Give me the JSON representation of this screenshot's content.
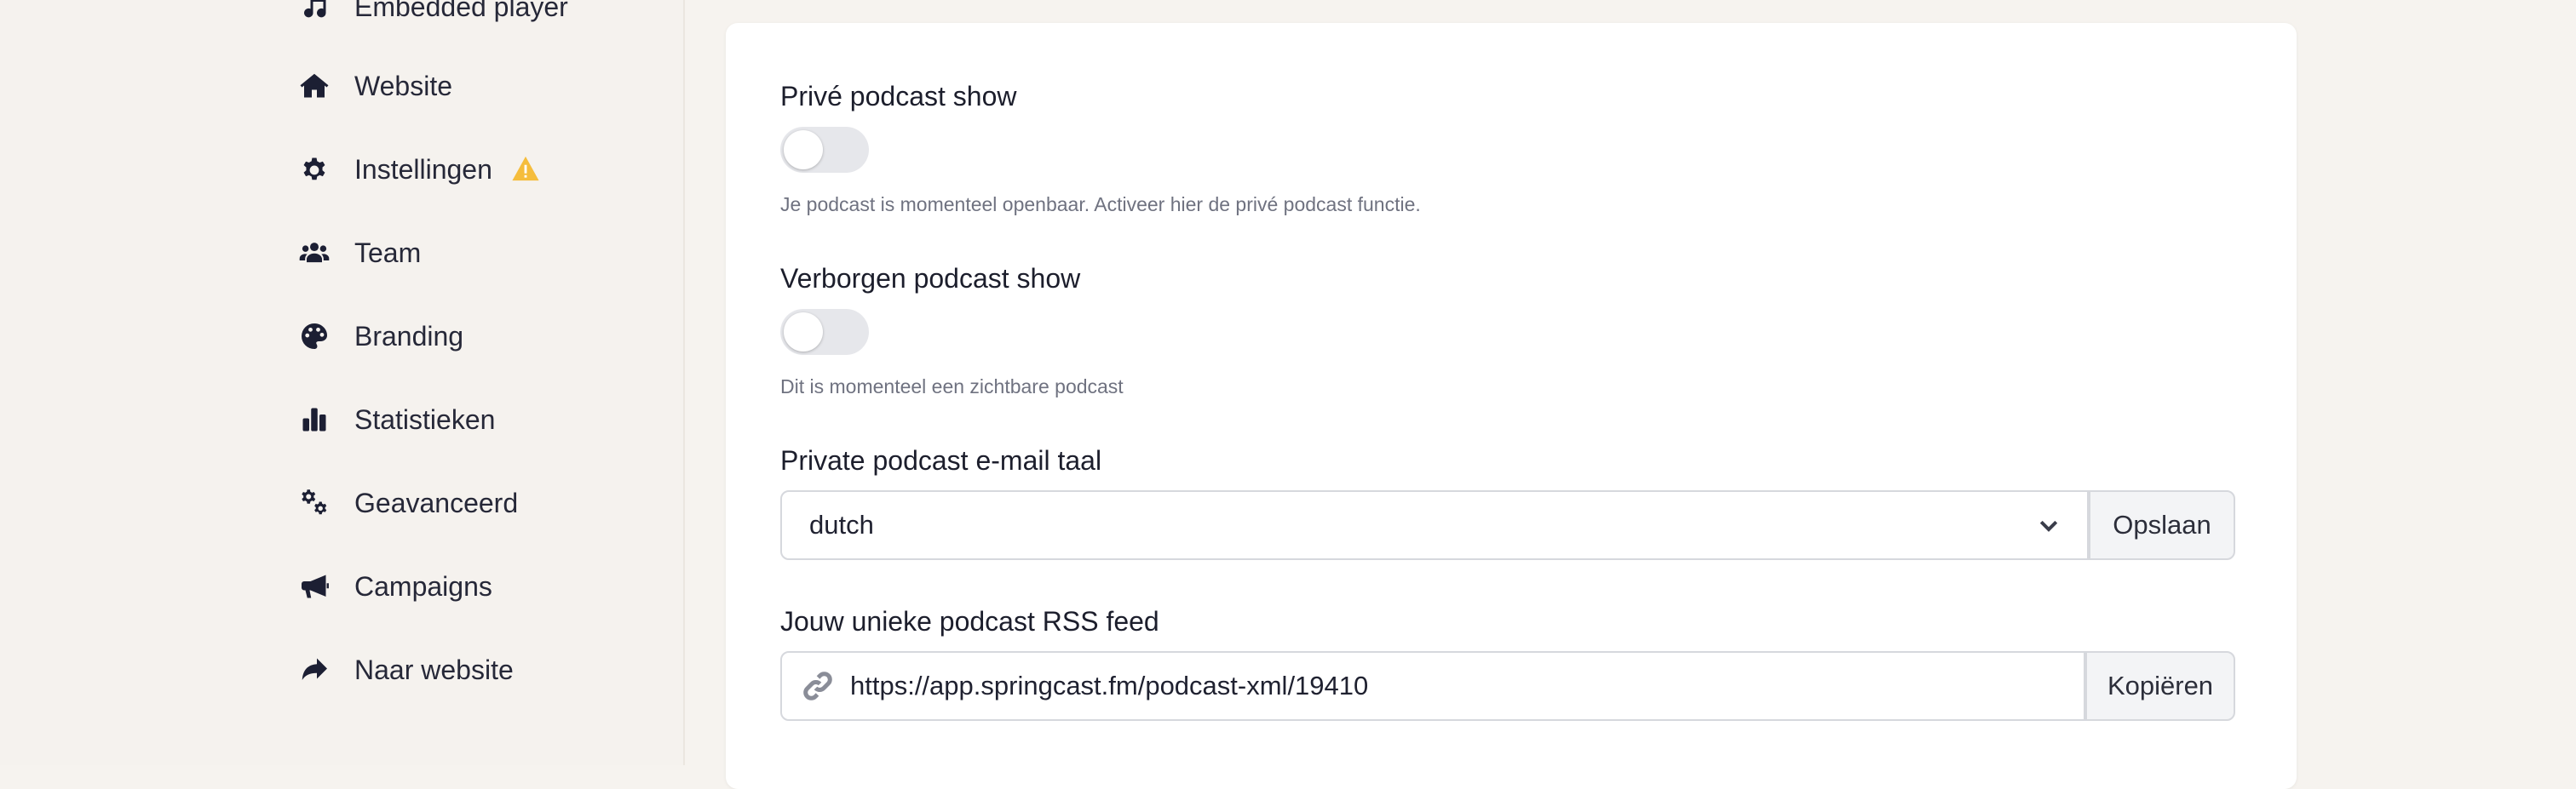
{
  "sidebar": {
    "items": [
      {
        "label": "Embedded player",
        "icon": "music-icon"
      },
      {
        "label": "Website",
        "icon": "home-icon"
      },
      {
        "label": "Instellingen",
        "icon": "gear-icon",
        "warning": "warning-icon"
      },
      {
        "label": "Team",
        "icon": "users-icon"
      },
      {
        "label": "Branding",
        "icon": "palette-icon"
      },
      {
        "label": "Statistieken",
        "icon": "bar-chart-icon"
      },
      {
        "label": "Geavanceerd",
        "icon": "gears-icon"
      },
      {
        "label": "Campaigns",
        "icon": "megaphone-icon"
      },
      {
        "label": "Naar website",
        "icon": "share-arrow-icon"
      }
    ]
  },
  "settings": {
    "private_show": {
      "label": "Privé podcast show",
      "enabled": false,
      "help": "Je podcast is momenteel openbaar. Activeer hier de privé podcast functie."
    },
    "hidden_show": {
      "label": "Verborgen podcast show",
      "enabled": false,
      "help": "Dit is momenteel een zichtbare podcast"
    },
    "email_language": {
      "label": "Private podcast e-mail taal",
      "value": "dutch",
      "save_label": "Opslaan"
    },
    "rss_feed": {
      "label": "Jouw unieke podcast RSS feed",
      "url": "https://app.springcast.fm/podcast-xml/19410",
      "copy_label": "Kopiëren"
    }
  },
  "colors": {
    "warning": "#f5bd3c",
    "toggle_off": "#e6e7eb",
    "page_bg": "#f5f2ee"
  }
}
